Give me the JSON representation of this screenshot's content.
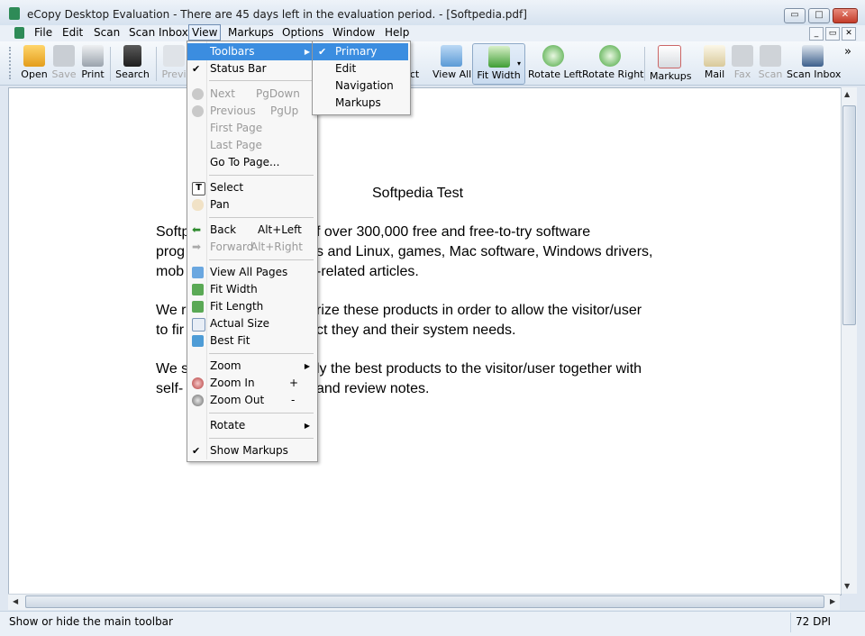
{
  "window": {
    "title": "eCopy Desktop Evaluation - There are 45 days left in the evaluation period. - [Softpedia.pdf]",
    "min_label": "▭",
    "max_label": "□",
    "close_label": "✕"
  },
  "menubar": {
    "items": [
      "File",
      "Edit",
      "Scan",
      "Scan Inbox",
      "View",
      "Markups",
      "Options",
      "Window",
      "Help"
    ],
    "mdi_buttons": [
      "_",
      "▭",
      "✕"
    ]
  },
  "toolbar": {
    "open": "Open",
    "save": "Save",
    "print": "Print",
    "search": "Search",
    "previous": "Previ",
    "select_tail": "ct",
    "view_all": "View All",
    "fit_width": "Fit Width",
    "rotate_left": "Rotate Left",
    "rotate_right": "Rotate Right",
    "markups": "Markups",
    "mail": "Mail",
    "fax": "Fax",
    "scan": "Scan",
    "scan_inbox": "Scan Inbox",
    "overflow": "»"
  },
  "view_menu": {
    "toolbars": "Toolbars",
    "status_bar": "Status Bar",
    "next": "Next",
    "next_key": "PgDown",
    "previous": "Previous",
    "previous_key": "PgUp",
    "first_page": "First Page",
    "last_page": "Last Page",
    "go_to_page": "Go To Page...",
    "select": "Select",
    "pan": "Pan",
    "back": "Back",
    "back_key": "Alt+Left",
    "forward": "Forward",
    "forward_key": "Alt+Right",
    "view_all_pages": "View All Pages",
    "fit_width": "Fit Width",
    "fit_length": "Fit Length",
    "actual_size": "Actual Size",
    "best_fit": "Best Fit",
    "zoom": "Zoom",
    "zoom_in": "Zoom In",
    "zoom_in_key": "+",
    "zoom_out": "Zoom Out",
    "zoom_out_key": "-",
    "rotate": "Rotate",
    "show_markups": "Show Markups"
  },
  "toolbars_submenu": {
    "primary": "Primary",
    "edit": "Edit",
    "navigation": "Navigation",
    "markups": "Markups"
  },
  "document": {
    "title": "Softpedia Test",
    "lines": [
      "Softp",
      "f over 300,000 free and free-to-try software",
      "prog",
      "s and Linux, games, Mac software, Windows drivers,",
      "mob",
      "-related articles.",
      "We r",
      "rize these products in order to allow the visitor/user",
      "to fir",
      "ct they and their system needs.",
      "We s",
      "ly the best products to the visitor/user together with",
      "self-",
      "and review notes."
    ]
  },
  "statusbar": {
    "message": "Show or hide the main toolbar",
    "dpi": "72 DPI"
  }
}
